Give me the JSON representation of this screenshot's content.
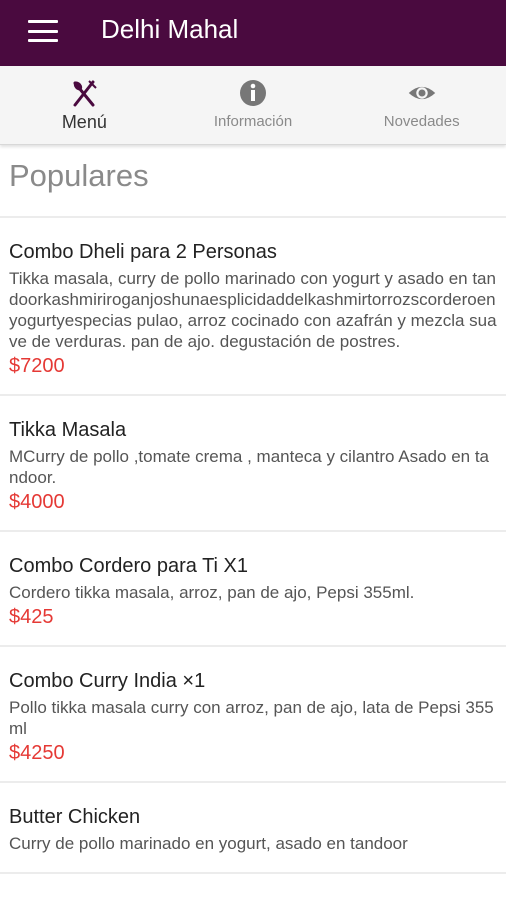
{
  "appbar": {
    "title": "Delhi Mahal"
  },
  "tabs": [
    {
      "label": "Menú",
      "icon": "fork-knife-icon"
    },
    {
      "label": "Información",
      "icon": "info-icon"
    },
    {
      "label": "Novedades",
      "icon": "eye-icon"
    }
  ],
  "section": {
    "title": "Populares"
  },
  "items": [
    {
      "name": "Combo Dheli para 2 Personas",
      "desc": "Tikka masala, curry de pollo marinado con yogurt y asado en tandoorkashmiriroganjoshunaesplicidaddelkashmirtorrozscorderoenyogurtyespecias pulao, arroz cocinado con azafrán y mezcla suave de verduras. pan de ajo. degustación de postres.",
      "price": "$7200"
    },
    {
      "name": "Tikka Masala",
      "desc": "MCurry de pollo ,tomate crema , manteca y cilantro Asado en tandoor.",
      "price": "$4000"
    },
    {
      "name": "Combo Cordero para Ti X1",
      "desc": "Cordero tikka masala, arroz, pan de ajo, Pepsi 355ml.",
      "price": "$425"
    },
    {
      "name": "Combo Curry India ×1",
      "desc": "Pollo tikka masala curry con arroz, pan de ajo, lata de Pepsi 355ml",
      "price": "$4250"
    },
    {
      "name": "Butter Chicken",
      "desc": "Curry de pollo marinado en yogurt, asado en tandoor",
      "price": ""
    }
  ],
  "colors": {
    "appbar": "#4a0a3f",
    "price": "#e53935"
  }
}
